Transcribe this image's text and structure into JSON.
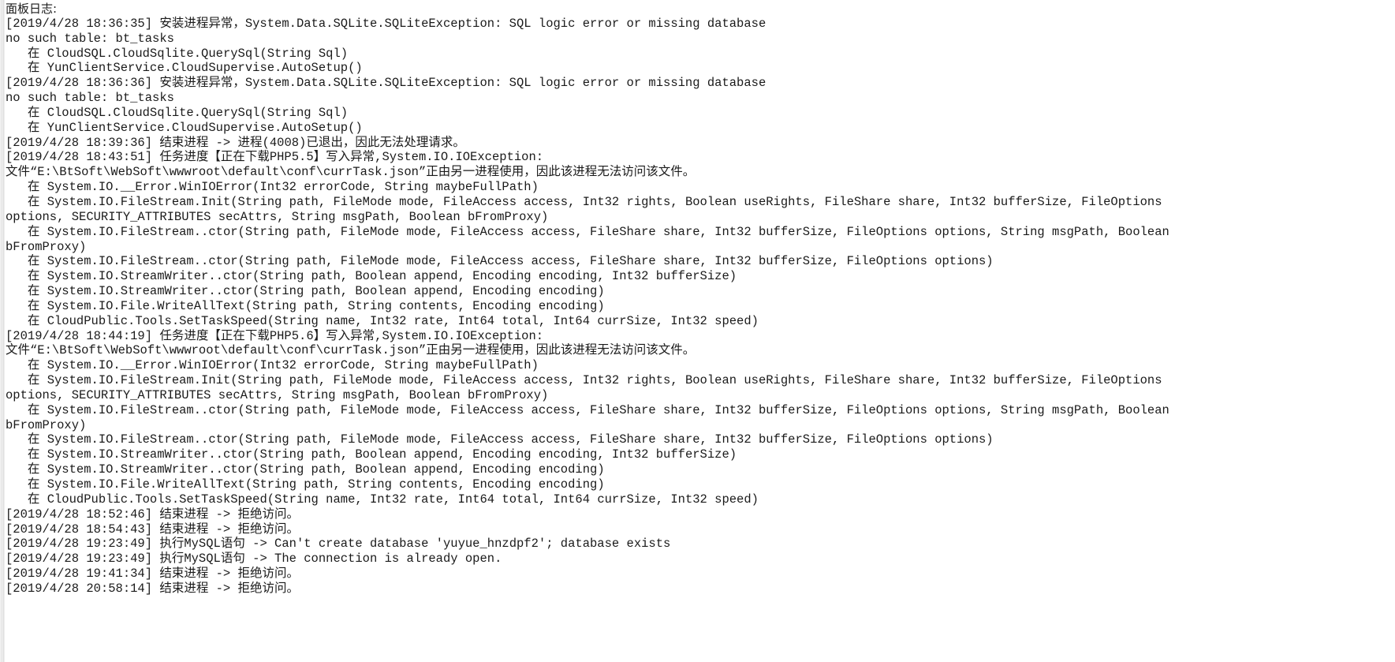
{
  "panel": {
    "title": "面板日志:",
    "background_color": "#ffffff",
    "text_color": "#1a1a1a",
    "gutter_color": "#dcdcdc"
  },
  "log": {
    "lines": [
      "[2019/4/28 18:36:35] 安装进程异常，System.Data.SQLite.SQLiteException: SQL logic error or missing database",
      "no such table: bt_tasks",
      "   在 CloudSQL.CloudSqlite.QuerySql(String Sql)",
      "   在 YunClientService.CloudSupervise.AutoSetup()",
      "[2019/4/28 18:36:36] 安装进程异常，System.Data.SQLite.SQLiteException: SQL logic error or missing database",
      "no such table: bt_tasks",
      "   在 CloudSQL.CloudSqlite.QuerySql(String Sql)",
      "   在 YunClientService.CloudSupervise.AutoSetup()",
      "[2019/4/28 18:39:36] 结束进程 -> 进程(4008)已退出，因此无法处理请求。",
      "[2019/4/28 18:43:51] 任务进度【正在下载PHP5.5】写入异常,System.IO.IOException:",
      "文件“E:\\BtSoft\\WebSoft\\wwwroot\\default\\conf\\currTask.json”正由另一进程使用，因此该进程无法访问该文件。",
      "   在 System.IO.__Error.WinIOError(Int32 errorCode, String maybeFullPath)",
      "   在 System.IO.FileStream.Init(String path, FileMode mode, FileAccess access, Int32 rights, Boolean useRights, FileShare share, Int32 bufferSize, FileOptions",
      "options, SECURITY_ATTRIBUTES secAttrs, String msgPath, Boolean bFromProxy)",
      "   在 System.IO.FileStream..ctor(String path, FileMode mode, FileAccess access, FileShare share, Int32 bufferSize, FileOptions options, String msgPath, Boolean",
      "bFromProxy)",
      "   在 System.IO.FileStream..ctor(String path, FileMode mode, FileAccess access, FileShare share, Int32 bufferSize, FileOptions options)",
      "   在 System.IO.StreamWriter..ctor(String path, Boolean append, Encoding encoding, Int32 bufferSize)",
      "   在 System.IO.StreamWriter..ctor(String path, Boolean append, Encoding encoding)",
      "   在 System.IO.File.WriteAllText(String path, String contents, Encoding encoding)",
      "   在 CloudPublic.Tools.SetTaskSpeed(String name, Int32 rate, Int64 total, Int64 currSize, Int32 speed)",
      "[2019/4/28 18:44:19] 任务进度【正在下载PHP5.6】写入异常,System.IO.IOException:",
      "文件“E:\\BtSoft\\WebSoft\\wwwroot\\default\\conf\\currTask.json”正由另一进程使用，因此该进程无法访问该文件。",
      "   在 System.IO.__Error.WinIOError(Int32 errorCode, String maybeFullPath)",
      "   在 System.IO.FileStream.Init(String path, FileMode mode, FileAccess access, Int32 rights, Boolean useRights, FileShare share, Int32 bufferSize, FileOptions",
      "options, SECURITY_ATTRIBUTES secAttrs, String msgPath, Boolean bFromProxy)",
      "   在 System.IO.FileStream..ctor(String path, FileMode mode, FileAccess access, FileShare share, Int32 bufferSize, FileOptions options, String msgPath, Boolean",
      "bFromProxy)",
      "   在 System.IO.FileStream..ctor(String path, FileMode mode, FileAccess access, FileShare share, Int32 bufferSize, FileOptions options)",
      "   在 System.IO.StreamWriter..ctor(String path, Boolean append, Encoding encoding, Int32 bufferSize)",
      "   在 System.IO.StreamWriter..ctor(String path, Boolean append, Encoding encoding)",
      "   在 System.IO.File.WriteAllText(String path, String contents, Encoding encoding)",
      "   在 CloudPublic.Tools.SetTaskSpeed(String name, Int32 rate, Int64 total, Int64 currSize, Int32 speed)",
      "[2019/4/28 18:52:46] 结束进程 -> 拒绝访问。",
      "[2019/4/28 18:54:43] 结束进程 -> 拒绝访问。",
      "[2019/4/28 19:23:49] 执行MySQL语句 -> Can't create database 'yuyue_hnzdpf2'; database exists",
      "[2019/4/28 19:23:49] 执行MySQL语句 -> The connection is already open.",
      "[2019/4/28 19:41:34] 结束进程 -> 拒绝访问。",
      "[2019/4/28 20:58:14] 结束进程 -> 拒绝访问。"
    ]
  }
}
